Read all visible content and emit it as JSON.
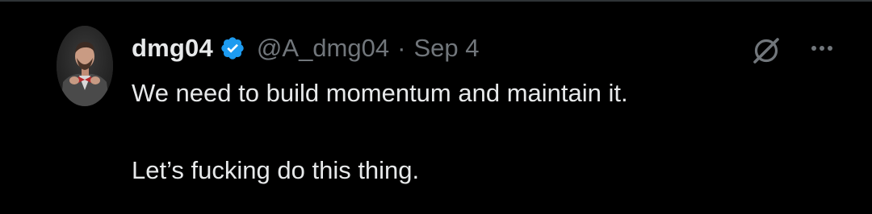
{
  "tweet": {
    "author": {
      "display_name": "dmg04",
      "handle": "@A_dmg04",
      "verified": true,
      "avatar_icon": "profile-photo"
    },
    "separator": "·",
    "date": "Sep 4",
    "text_lines": [
      "We need to build momentum and maintain it.",
      "",
      "Let’s fucking do this thing."
    ],
    "actions": {
      "grok_icon": "grok-icon",
      "more_icon": "more-options-icon"
    }
  },
  "colors": {
    "background": "#000000",
    "text_primary": "#e7e9ea",
    "text_secondary": "#71767b",
    "verified_badge": "#1d9bf0",
    "divider": "#2f3336"
  }
}
